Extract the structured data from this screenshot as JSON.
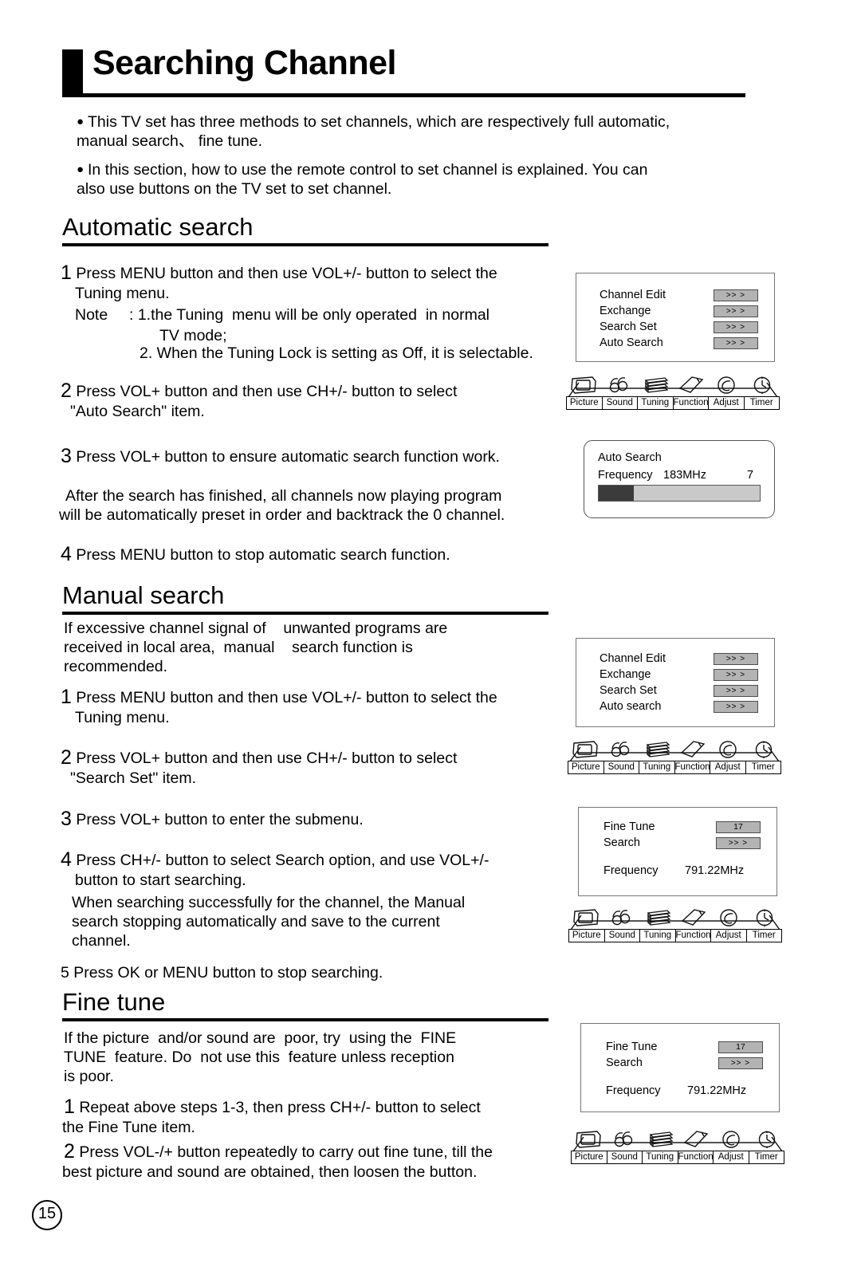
{
  "page": {
    "title": "Searching Channel",
    "number": "15"
  },
  "intro": {
    "bullet1": "This TV set has three methods to set channels, which are respectively full automatic,",
    "bullet1_cont": "manual search、 fine tune.",
    "bullet2": "In this section, how to use the remote control  to set channel is explained. You can",
    "bullet2_cont": "also use buttons on the TV set to set channel."
  },
  "sections": {
    "automatic": {
      "heading": "Automatic search",
      "step1_num": "1",
      "step1_line1": "Press MENU button and then use VOL+/- button to select the",
      "step1_line2": "Tuning menu.",
      "note_label": "Note",
      "note1": ": 1.the Tuning  menu will be only operated  in normal",
      "note1_cont": "TV mode;",
      "note2": "2. When the Tuning Lock is setting as Off, it is selectable.",
      "step2_num": "2",
      "step2_line1": "Press VOL+ button and then use CH+/- button to select",
      "step2_line2": "\"Auto Search\" item.",
      "step3_num": "3",
      "step3_line1": "Press VOL+ button to ensure automatic search function work.",
      "para_line1": "After the search has finished, all channels now playing program",
      "para_line2": "will be automatically preset in order and backtrack the 0 channel.",
      "step4_num": "4",
      "step4_line1": "Press MENU button to stop automatic search function."
    },
    "manual": {
      "heading": "Manual search",
      "intro_line1": "If excessive channel signal of    unwanted programs are",
      "intro_line2": "received in local area,  manual    search function is",
      "intro_line3": "recommended.",
      "step1_num": "1",
      "step1_line1": "Press MENU button and then use VOL+/- button to select the",
      "step1_line2": "Tuning menu.",
      "step2_num": "2",
      "step2_line1": "Press VOL+ button and then use CH+/- button  to select",
      "step2_line2": "\"Search Set\" item.",
      "step3_num": "3",
      "step3_line1": "Press VOL+ button to enter the submenu.",
      "step4_num": "4",
      "step4_line1": "Press CH+/- button to select Search option, and use VOL+/-",
      "step4_line2": "button to start searching.",
      "step4_line3": "When searching successfully for the channel, the Manual",
      "step4_line4": "search stopping automatically and save to the current",
      "step4_line5": "channel.",
      "step5_num": "5",
      "step5_line1": "Press OK or MENU button to stop searching."
    },
    "finetune": {
      "heading": "Fine tune",
      "intro_line1": "If the picture  and/or sound are  poor, try  using the  FINE",
      "intro_line2": "TUNE  feature. Do  not use this  feature unless reception",
      "intro_line3": "is poor.",
      "step1_num": "1",
      "step1_line1": "Repeat above steps 1-3,  then press CH+/- button to select",
      "step1_line2": "the Fine Tune item.",
      "step2_num": "2",
      "step2_line1": "Press VOL-/+ button repeatedly to carry out fine tune, till the",
      "step2_line2": "best picture and sound are obtained, then loosen the button."
    }
  },
  "osd": {
    "tuning_menu_1": {
      "rows": [
        {
          "label": "Channel Edit",
          "chip": ">> >"
        },
        {
          "label": "Exchange",
          "chip": ">> >"
        },
        {
          "label": "Search Set",
          "chip": ">> >"
        },
        {
          "label": "Auto Search",
          "chip": ">> >"
        }
      ]
    },
    "tuning_menu_2": {
      "rows": [
        {
          "label": "Channel Edit",
          "chip": ">> >"
        },
        {
          "label": "Exchange",
          "chip": ">> >"
        },
        {
          "label": "Search Set",
          "chip": ">> >"
        },
        {
          "label": "Auto search",
          "chip": ">> >"
        }
      ]
    },
    "auto_search_dialog": {
      "title": "Auto Search",
      "freq_label": "Frequency",
      "freq_value": "183MHz",
      "channel": "7",
      "progress_percent": 22
    },
    "search_set_menu": {
      "rows": [
        {
          "label": "Fine Tune",
          "chip": "17"
        },
        {
          "label": "Search",
          "chip": ">> >"
        }
      ],
      "freq_label": "Frequency",
      "freq_value": "791.22MHz"
    },
    "fine_tune_menu": {
      "rows": [
        {
          "label": "Fine Tune",
          "chip": "17"
        },
        {
          "label": "Search",
          "chip": ">> >"
        }
      ],
      "freq_label": "Frequency",
      "freq_value": "791.22MHz"
    },
    "iconbar": {
      "items": [
        {
          "label": "Picture",
          "icon": "tv-screen-icon"
        },
        {
          "label": "Sound",
          "icon": "speaker-note-icon"
        },
        {
          "label": "Tuning",
          "icon": "stacked-waves-icon"
        },
        {
          "label": "Function",
          "icon": "tilted-card-icon"
        },
        {
          "label": "Adjust",
          "icon": "circle-swirl-icon"
        },
        {
          "label": "Timer",
          "icon": "clock-icon"
        }
      ]
    }
  },
  "colors": {
    "chip_fill": "#b3b3b3",
    "progress_fill": "#3b3b3b",
    "progress_track": "#c9c9c9",
    "rule": "#000000"
  }
}
